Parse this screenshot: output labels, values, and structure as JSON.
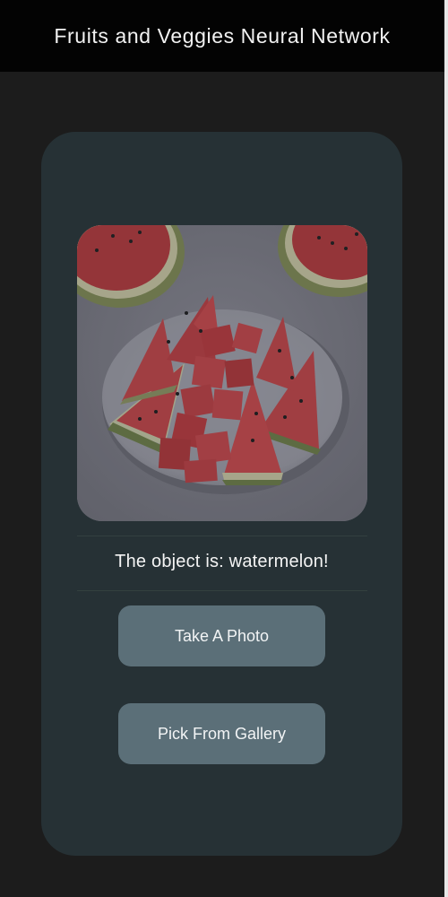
{
  "app_bar": {
    "title": "Fruits and Veggies Neural Network"
  },
  "main": {
    "image_subject": "watermelon-slices-on-plate",
    "result_text": "The object is: watermelon!",
    "buttons": {
      "take_photo": "Take A Photo",
      "pick_gallery": "Pick From Gallery"
    }
  },
  "colors": {
    "background": "#1c1c1c",
    "app_bar": "#030303",
    "card": "#263135",
    "button": "#5b6f78",
    "text": "#f2f2f2"
  }
}
